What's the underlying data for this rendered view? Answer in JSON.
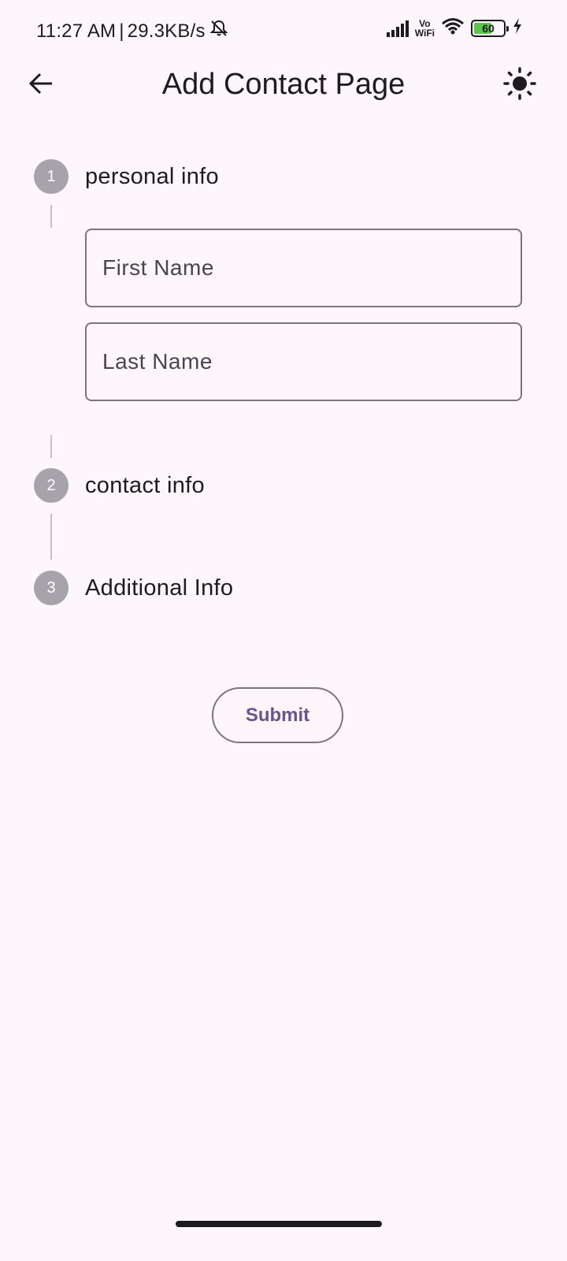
{
  "status_bar": {
    "time": "11:27 AM",
    "separator": "|",
    "net_speed": "29.3KB/s",
    "mute_icon": "bell-off-icon",
    "signal_icon": "cellular-signal-icon",
    "vowifi_top": "Vo",
    "vowifi_bottom": "WiFi",
    "wifi_icon": "wifi-icon",
    "battery_level": "60",
    "battery_percent": 60,
    "battery_color": "#5ac54c",
    "charging_icon": "bolt-icon"
  },
  "app_bar": {
    "back_icon": "arrow-left-icon",
    "title": "Add Contact Page",
    "theme_icon": "sun-icon"
  },
  "stepper": {
    "steps": [
      {
        "number": "1",
        "title": "personal info",
        "fields": [
          {
            "placeholder": "First Name",
            "value": ""
          },
          {
            "placeholder": "Last Name",
            "value": ""
          }
        ]
      },
      {
        "number": "2",
        "title": "contact info"
      },
      {
        "number": "3",
        "title": "Additional Info"
      }
    ]
  },
  "submit_label": "Submit",
  "colors": {
    "background": "#fdf7fc",
    "accent": "#65558f",
    "step_circle": "#a6a3aa",
    "outline": "#79747e"
  }
}
